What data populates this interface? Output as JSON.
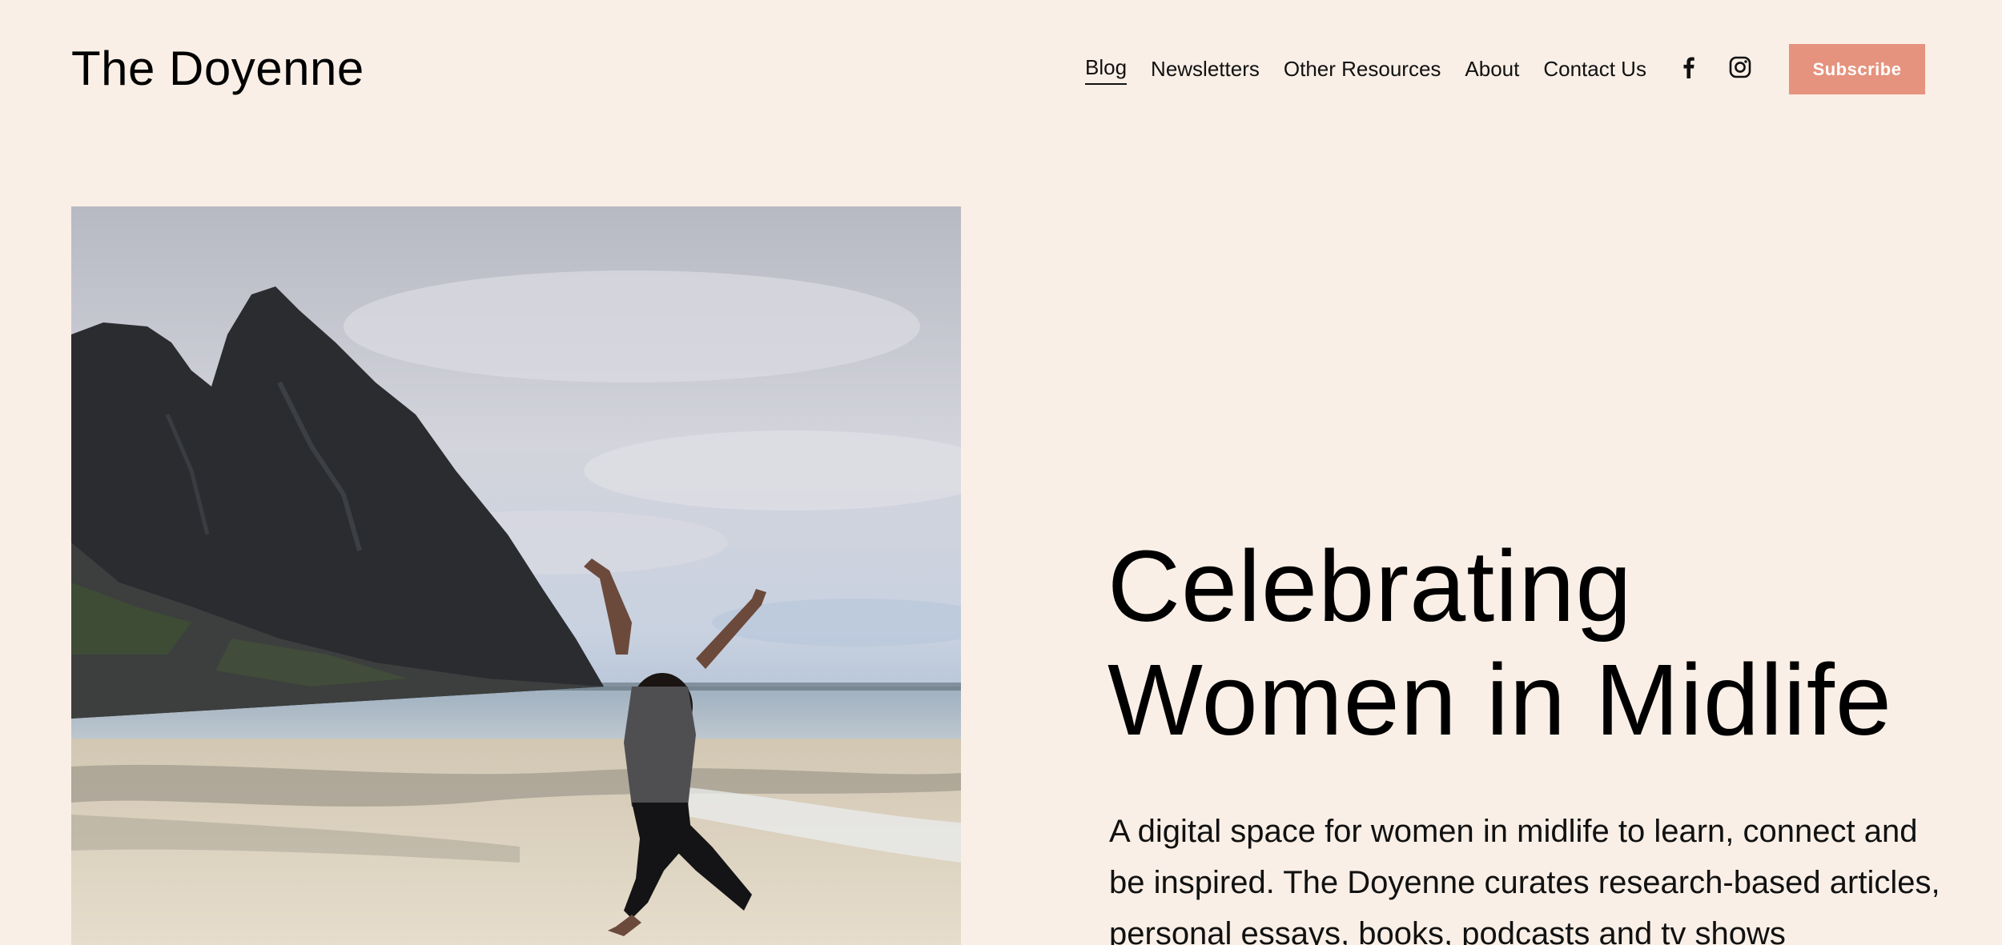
{
  "site": {
    "title": "The Doyenne"
  },
  "nav": {
    "items": [
      {
        "label": "Blog",
        "active": true
      },
      {
        "label": "Newsletters",
        "active": false
      },
      {
        "label": "Other Resources",
        "active": false
      },
      {
        "label": "About",
        "active": false
      },
      {
        "label": "Contact Us",
        "active": false
      }
    ]
  },
  "social": {
    "icons": [
      "facebook-icon",
      "instagram-icon"
    ]
  },
  "header": {
    "subscribe_label": "Subscribe"
  },
  "hero": {
    "headline_line1": "Celebrating",
    "headline_line2": "Women in Midlife",
    "description": "A digital space for women in midlife to learn, connect and be inspired. The Doyenne curates research-based articles, personal essays, books, podcasts and tv shows"
  },
  "colors": {
    "background": "#f9efe6",
    "accent": "#e5937e",
    "text": "#000000"
  }
}
